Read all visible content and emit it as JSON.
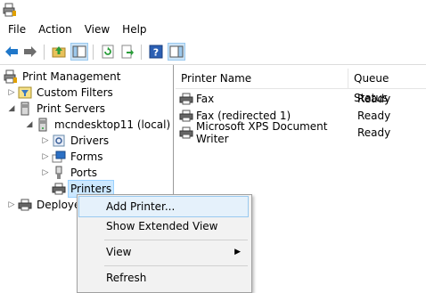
{
  "menubar": {
    "items": [
      "File",
      "Action",
      "View",
      "Help"
    ]
  },
  "tree": {
    "root": "Print Management",
    "custom_filters": "Custom Filters",
    "print_servers": "Print Servers",
    "server": "mcndesktop11 (local)",
    "drivers": "Drivers",
    "forms": "Forms",
    "ports": "Ports",
    "printers": "Printers",
    "deployed": "Deploye"
  },
  "list": {
    "columns": [
      "Printer Name",
      "Queue Status"
    ],
    "rows": [
      {
        "name": "Fax",
        "status": "Ready"
      },
      {
        "name": "Fax (redirected 1)",
        "status": "Ready"
      },
      {
        "name": "Microsoft XPS Document Writer",
        "status": "Ready"
      }
    ]
  },
  "context_menu": {
    "items": [
      "Add Printer...",
      "Show Extended View",
      "View",
      "Refresh"
    ]
  },
  "icons": {
    "app": "print-management-icon",
    "back": "back-arrow-icon",
    "forward": "forward-arrow-icon",
    "up": "up-folder-icon",
    "show_hide": "show-hide-tree-icon",
    "refresh": "refresh-icon",
    "export": "export-list-icon",
    "help": "help-icon",
    "action_pane": "action-pane-icon"
  },
  "colors": {
    "selection": "#cce8ff",
    "menu_hover": "#e5f1fb",
    "toolbar_selected": "#cce4f7"
  }
}
